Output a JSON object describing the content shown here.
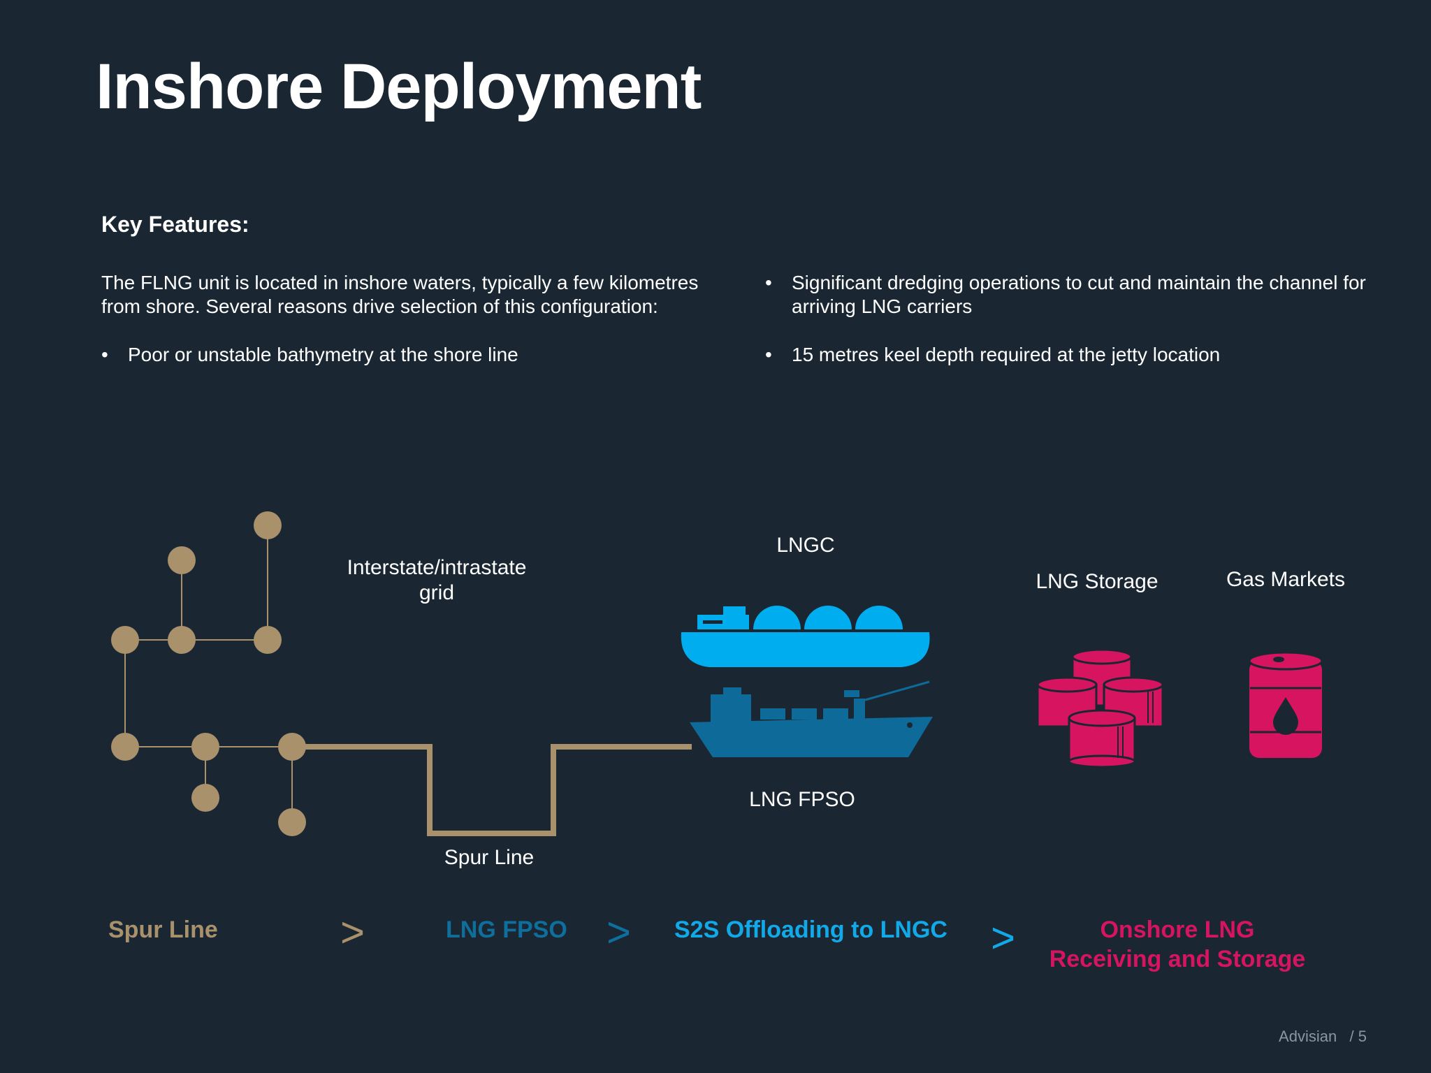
{
  "title": "Inshore Deployment",
  "key_features_heading": "Key Features:",
  "intro": "The FLNG unit is located in inshore waters, typically a few kilometres from shore. Several reasons drive selection of this configuration:",
  "bullets": [
    "Poor or unstable bathymetry at the shore line",
    "Significant dredging operations to cut and maintain the channel for arriving LNG carriers",
    "15 metres keel depth required at the jetty location"
  ],
  "bullet_symbol": "•",
  "diagram": {
    "grid_label": "Interstate/intrastate grid",
    "spur_label": "Spur Line",
    "lngc_label": "LNGC",
    "fpso_label": "LNG FPSO",
    "storage_label": "LNG Storage",
    "markets_label": "Gas Markets"
  },
  "process_steps": [
    {
      "label": "Spur Line",
      "color": "#a8916b"
    },
    {
      "label": "LNG FPSO",
      "color": "#0e6f9c"
    },
    {
      "label": "S2S Offloading to LNGC",
      "color": "#12a9e8"
    },
    {
      "label": "Onshore LNG Receiving and Storage",
      "color": "#d6145f"
    }
  ],
  "arrow_symbol": ">",
  "footer": {
    "brand": "Advisian",
    "page": "/ 5"
  },
  "colors": {
    "background": "#1a2733",
    "pipeline": "#a8916b",
    "lngc": "#00aeef",
    "fpso": "#0e6a99",
    "storage": "#d6145f"
  }
}
